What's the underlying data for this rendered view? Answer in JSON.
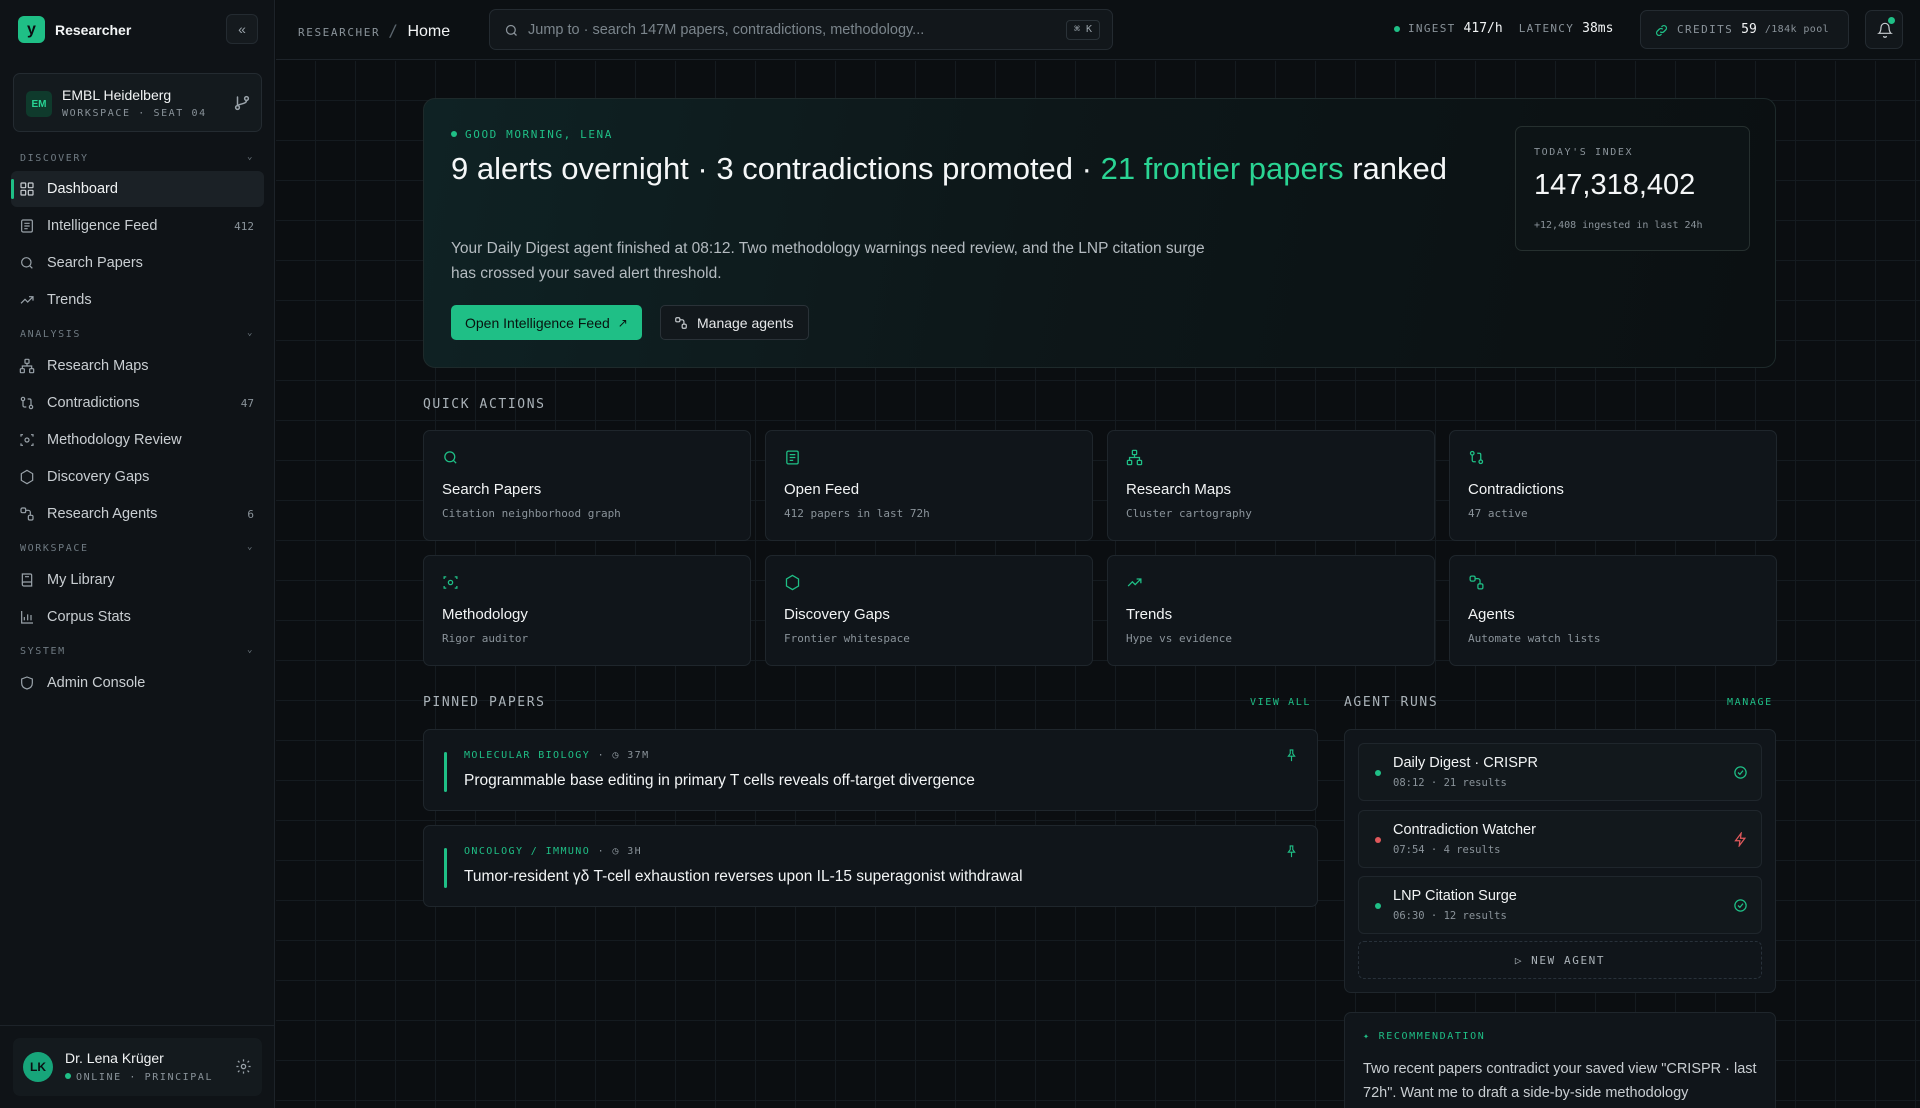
{
  "app": {
    "name": "Researcher",
    "logo_letter": "y"
  },
  "workspace": {
    "initials": "EM",
    "name": "EMBL Heidelberg",
    "sub": "WORKSPACE · SEAT 04"
  },
  "nav": {
    "discovery_label": "DISCOVERY",
    "analysis_label": "ANALYSIS",
    "workspace_label": "WORKSPACE",
    "system_label": "SYSTEM",
    "discovery": [
      {
        "label": "Dashboard",
        "icon": "grid-icon",
        "active": true
      },
      {
        "label": "Intelligence Feed",
        "icon": "newspaper-icon",
        "count": "412"
      },
      {
        "label": "Search Papers",
        "icon": "search-icon"
      },
      {
        "label": "Trends",
        "icon": "trending-up-icon"
      }
    ],
    "analysis": [
      {
        "label": "Research Maps",
        "icon": "network-icon"
      },
      {
        "label": "Contradictions",
        "icon": "git-compare-icon",
        "count": "47"
      },
      {
        "label": "Methodology Review",
        "icon": "scan-icon"
      },
      {
        "label": "Discovery Gaps",
        "icon": "hexagon-icon"
      },
      {
        "label": "Research Agents",
        "icon": "workflow-icon",
        "count": "6"
      }
    ],
    "workspace": [
      {
        "label": "My Library",
        "icon": "book-icon"
      },
      {
        "label": "Corpus Stats",
        "icon": "bar-chart-icon"
      }
    ],
    "system": [
      {
        "label": "Admin Console",
        "icon": "shield-icon"
      }
    ]
  },
  "user": {
    "initials": "LK",
    "name": "Dr. Lena Krüger",
    "status": "ONLINE · PRINCIPAL"
  },
  "topbar": {
    "crumb_root": "RESEARCHER",
    "crumb_sep": "/",
    "crumb_current": "Home",
    "search_placeholder": "Jump to · search 147M papers, contradictions, methodology...",
    "search_shortcut": "⌘ K",
    "ingest_label": "INGEST",
    "ingest_value": "417/h",
    "latency_label": "LATENCY",
    "latency_value": "38ms",
    "credits_label": "CREDITS",
    "credits_value": "59",
    "credits_pool": "/184k pool"
  },
  "hero": {
    "greeting": "GOOD MORNING, LENA",
    "headline_main": "9 alerts overnight · 3 contradictions promoted · ",
    "headline_highlight": "21 frontier papers",
    "headline_end": " ranked",
    "description": "Your Daily Digest agent finished at 08:12. Two methodology warnings need review, and the LNP citation surge has crossed your saved alert threshold.",
    "primary_button": "Open Intelligence Feed",
    "primary_button_icon": "↗",
    "secondary_button": "Manage agents",
    "index_label": "TODAY'S INDEX",
    "index_value": "147,318,402",
    "index_sub": "+12,408 ingested in last 24h"
  },
  "quick_actions": {
    "title": "QUICK ACTIONS",
    "items": [
      {
        "title": "Search Papers",
        "sub": "Citation neighborhood graph",
        "icon": "search-icon"
      },
      {
        "title": "Open Feed",
        "sub": "412 papers in last 72h",
        "icon": "newspaper-icon"
      },
      {
        "title": "Research Maps",
        "sub": "Cluster cartography",
        "icon": "network-icon"
      },
      {
        "title": "Contradictions",
        "sub": "47 active",
        "icon": "git-compare-icon"
      },
      {
        "title": "Methodology",
        "sub": "Rigor auditor",
        "icon": "scan-icon"
      },
      {
        "title": "Discovery Gaps",
        "sub": "Frontier whitespace",
        "icon": "hexagon-icon"
      },
      {
        "title": "Trends",
        "sub": "Hype vs evidence",
        "icon": "trending-up-icon"
      },
      {
        "title": "Agents",
        "sub": "Automate watch lists",
        "icon": "workflow-icon"
      }
    ]
  },
  "pinned": {
    "title": "PINNED PAPERS",
    "link": "VIEW ALL",
    "items": [
      {
        "category": "MOLECULAR BIOLOGY",
        "time": "37M",
        "title": "Programmable base editing in primary T cells reveals off-target divergence"
      },
      {
        "category": "ONCOLOGY / IMMUNO",
        "time": "3H",
        "title": "Tumor-resident γδ T-cell exhaustion reverses upon IL-15 superagonist withdrawal"
      }
    ]
  },
  "agent_runs": {
    "title": "AGENT RUNS",
    "link": "MANAGE",
    "items": [
      {
        "name": "Daily Digest · CRISPR",
        "sub": "08:12 · 21 results",
        "status": "success",
        "color": "#1fbf86"
      },
      {
        "name": "Contradiction Watcher",
        "sub": "07:54 · 4 results",
        "status": "alert",
        "color": "#e0585b"
      },
      {
        "name": "LNP Citation Surge",
        "sub": "06:30 · 12 results",
        "status": "success",
        "color": "#1fbf86"
      }
    ],
    "new_agent": "NEW AGENT"
  },
  "recommendation": {
    "label": "RECOMMENDATION",
    "body": "Two recent papers contradict your saved view \"CRISPR · last 72h\". Want me to draft a side-by-side methodology"
  },
  "colors": {
    "accent": "#1fbf86",
    "alert": "#e0585b",
    "background": "#0b0e11"
  }
}
